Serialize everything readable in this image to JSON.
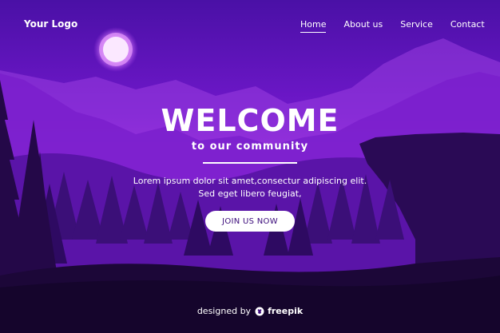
{
  "header": {
    "logo": "Your Logo",
    "nav": [
      {
        "label": "Home",
        "active": true
      },
      {
        "label": "About us",
        "active": false
      },
      {
        "label": "Service",
        "active": false
      },
      {
        "label": "Contact",
        "active": false
      }
    ]
  },
  "hero": {
    "title": "WELCOME",
    "subtitle": "to our community",
    "description_line1": "Lorem ipsum dolor sit amet,consectur adipiscing elit.",
    "description_line2": "Sed eget libero feugiat,",
    "cta_label": "JOIN US NOW"
  },
  "footer": {
    "prefix": "designed by",
    "brand": "freepik",
    "icon": "freepik-icon"
  },
  "colors": {
    "sky_top": "#4c0fa8",
    "sky_mid": "#8b1fd6",
    "ground": "#1c0738",
    "moon": "#f4d8ff",
    "button_text": "#3a0a7a"
  }
}
